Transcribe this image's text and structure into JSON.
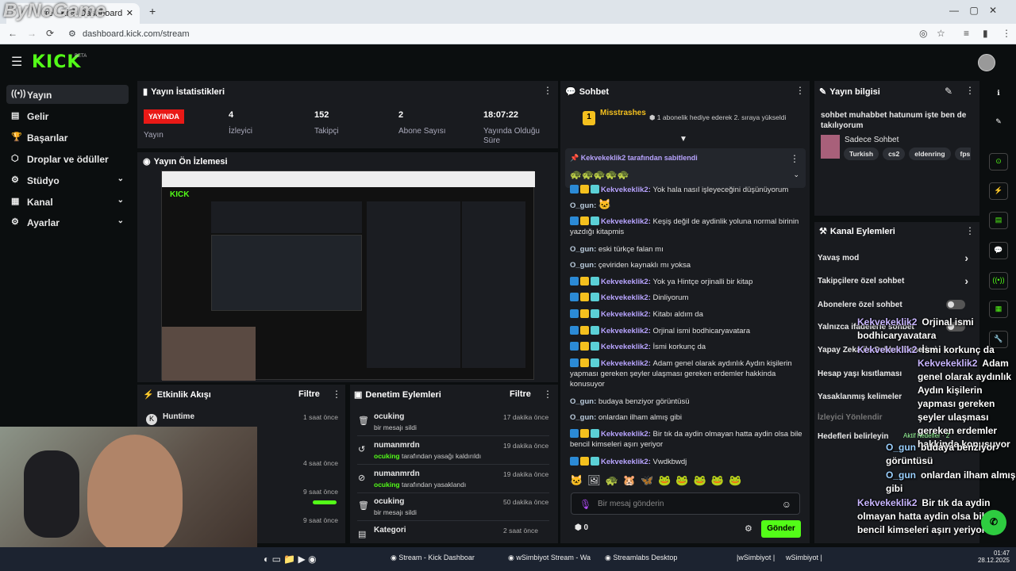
{
  "browser": {
    "tab_title": "tre - Kick Dashboard",
    "url": "dashboard.kick.com/stream",
    "watermark": "ByNoGame"
  },
  "header": {
    "logo": "KICK",
    "beta": "BETA"
  },
  "sidebar": {
    "items": [
      {
        "label": "Yayın",
        "icon": "radio-icon"
      },
      {
        "label": "Gelir",
        "icon": "money-icon"
      },
      {
        "label": "Başarılar",
        "icon": "trophy-icon"
      },
      {
        "label": "Droplar ve ödüller",
        "icon": "gift-icon"
      },
      {
        "label": "Stüdyo",
        "icon": "studio-icon"
      },
      {
        "label": "Kanal",
        "icon": "channel-icon"
      },
      {
        "label": "Ayarlar",
        "icon": "gear-icon"
      }
    ]
  },
  "stats": {
    "title": "Yayın İstatistikleri",
    "live": "YAYINDA",
    "live_label": "Yayın",
    "items": [
      {
        "value": "4",
        "label": "İzleyici"
      },
      {
        "value": "152",
        "label": "Takipçi"
      },
      {
        "value": "2",
        "label": "Abone Sayısı"
      },
      {
        "value": "18:07:22",
        "label": "Yayında Olduğu Süre"
      }
    ]
  },
  "preview": {
    "title": "Yayın Ön İzlemesi"
  },
  "activity": {
    "title": "Etkinlik Akışı",
    "filter": "Filtre",
    "rows": [
      {
        "name": "Huntime",
        "time": "1 saat önce"
      },
      {
        "name": "",
        "time": "4 saat önce"
      },
      {
        "name": "",
        "time": "9 saat önce"
      },
      {
        "name": "",
        "time": "9 saat önce"
      }
    ]
  },
  "moderation": {
    "title": "Denetim Eylemleri",
    "filter": "Filtre",
    "rows": [
      {
        "user": "ocuking",
        "desc": "bir mesajı sildi",
        "time": "17 dakika önce",
        "icon": "trash-icon"
      },
      {
        "user": "numanmrdn",
        "desc": "ocuking tarafından yasağı kaldırıldı",
        "time": "19 dakika önce",
        "icon": "undo-icon"
      },
      {
        "user": "numanmrdn",
        "desc": "ocuking tarafından yasaklandı",
        "time": "19 dakika önce",
        "icon": "ban-icon"
      },
      {
        "user": "ocuking",
        "desc": "bir mesajı sildi",
        "time": "50 dakika önce",
        "icon": "trash-icon"
      },
      {
        "user": "Kategori",
        "desc": "",
        "time": "2 saat önce",
        "icon": "category-icon"
      }
    ]
  },
  "chat": {
    "title": "Sohbet",
    "top_user": "Misstrashes",
    "top_note": "1 abonelik hediye ederek 2. sıraya yükseldi",
    "pinned_by": "Kekvekeklik2 tarafından sabitlendi",
    "placeholder": "Bir mesaj gönderin",
    "points": "0",
    "send": "Gönder",
    "messages": [
      {
        "user": "Kekvekeklik2",
        "text": "Yok hala nasıl işleyeceğini düşünüyorum"
      },
      {
        "user": "O_gun",
        "text": ""
      },
      {
        "user": "Kekvekeklik2",
        "text": "Keşiş değil de aydinlik yoluna normal birinin yazdığı kitapmis"
      },
      {
        "user": "O_gun",
        "text": "eski türkçe falan mı"
      },
      {
        "user": "O_gun",
        "text": "çeviriden kaynaklı mı yoksa"
      },
      {
        "user": "Kekvekeklik2",
        "text": "Yok ya Hintçe orjinalli bir kitap"
      },
      {
        "user": "Kekvekeklik2",
        "text": "Dinliyorum"
      },
      {
        "user": "Kekvekeklik2",
        "text": "Kitabı aldım da"
      },
      {
        "user": "Kekvekeklik2",
        "text": "Orjinal ismi bodhicaryavatara"
      },
      {
        "user": "Kekvekeklik2",
        "text": "İsmi korkunç da"
      },
      {
        "user": "Kekvekeklik2",
        "text": "Adam genel olarak aydınlık Aydın kişilerin yapması gereken şeyler ulaşması gereken erdemler hakkinda konusuyor"
      },
      {
        "user": "O_gun",
        "text": "budaya benziyor görüntüsü"
      },
      {
        "user": "O_gun",
        "text": "onlardan ilham almış gibi"
      },
      {
        "user": "Kekvekeklik2",
        "text": "Bir tık da aydin olmayan hatta aydin olsa bile bencil kimseleri aşırı yeriyor"
      },
      {
        "user": "Kekvekeklik2",
        "text": "Vwdkbwdj"
      }
    ]
  },
  "info": {
    "title": "Yayın bilgisi",
    "stream_title": "sohbet muhabbet hatunum işte ben de takılıyorum",
    "category": "Sadece Sohbet",
    "tags": [
      "Turkish",
      "cs2",
      "eldenring",
      "fps"
    ]
  },
  "actions": {
    "title": "Kanal Eylemleri",
    "items": [
      "Yavaş mod",
      "Takipçilere özel sohbet",
      "Abonelere özel sohbet",
      "Yalnızca ifadelerle sohbet",
      "Yapay Zeka ile Sohbet Denetimi",
      "Hesap yaşı kısıtlaması",
      "Yasaklanmış kelimeler",
      "İzleyici Yönlendir",
      "Hedefleri belirleyin"
    ]
  },
  "overlay": {
    "lines": [
      {
        "user": "Kekvekeklik2",
        "text": "Orjinal ismi bodhicaryavatara"
      },
      {
        "user": "Kekvekeklik2",
        "text": "İsmi korkunç da"
      },
      {
        "user": "Kekvekeklik2",
        "text": "Adam genel olarak aydınlık Aydın kişilerin yapması gereken şeyler ulaşması gereken erdemler hakkinda konusuyor"
      },
      {
        "user": "O_gun",
        "text": "budaya benziyor görüntüsü"
      },
      {
        "user": "O_gun",
        "text": "onlardan ilham almış gibi"
      },
      {
        "user": "Kekvekeklik2",
        "text": "Bir tık da aydin olmayan hatta aydin olsa bile bencil kimseleri aşırı yeriyor"
      },
      {
        "user": "Kekvekeklik2",
        "text": "Vwdkbwdj"
      }
    ],
    "aktif": "Aktif hedefler · 2"
  },
  "taskbar": {
    "items": [
      "Stream - Kick Dashboar",
      "wSimbiyot Stream - Wa",
      "Streamlabs Desktop",
      "|wSimbiyot |",
      "wSimbiyot |"
    ],
    "time": "01:47",
    "date": "28.12.2025"
  },
  "colors": {
    "accent": "#53fc18",
    "live": "#e91916",
    "panel": "#191b1f",
    "bg": "#0b0e0f"
  }
}
